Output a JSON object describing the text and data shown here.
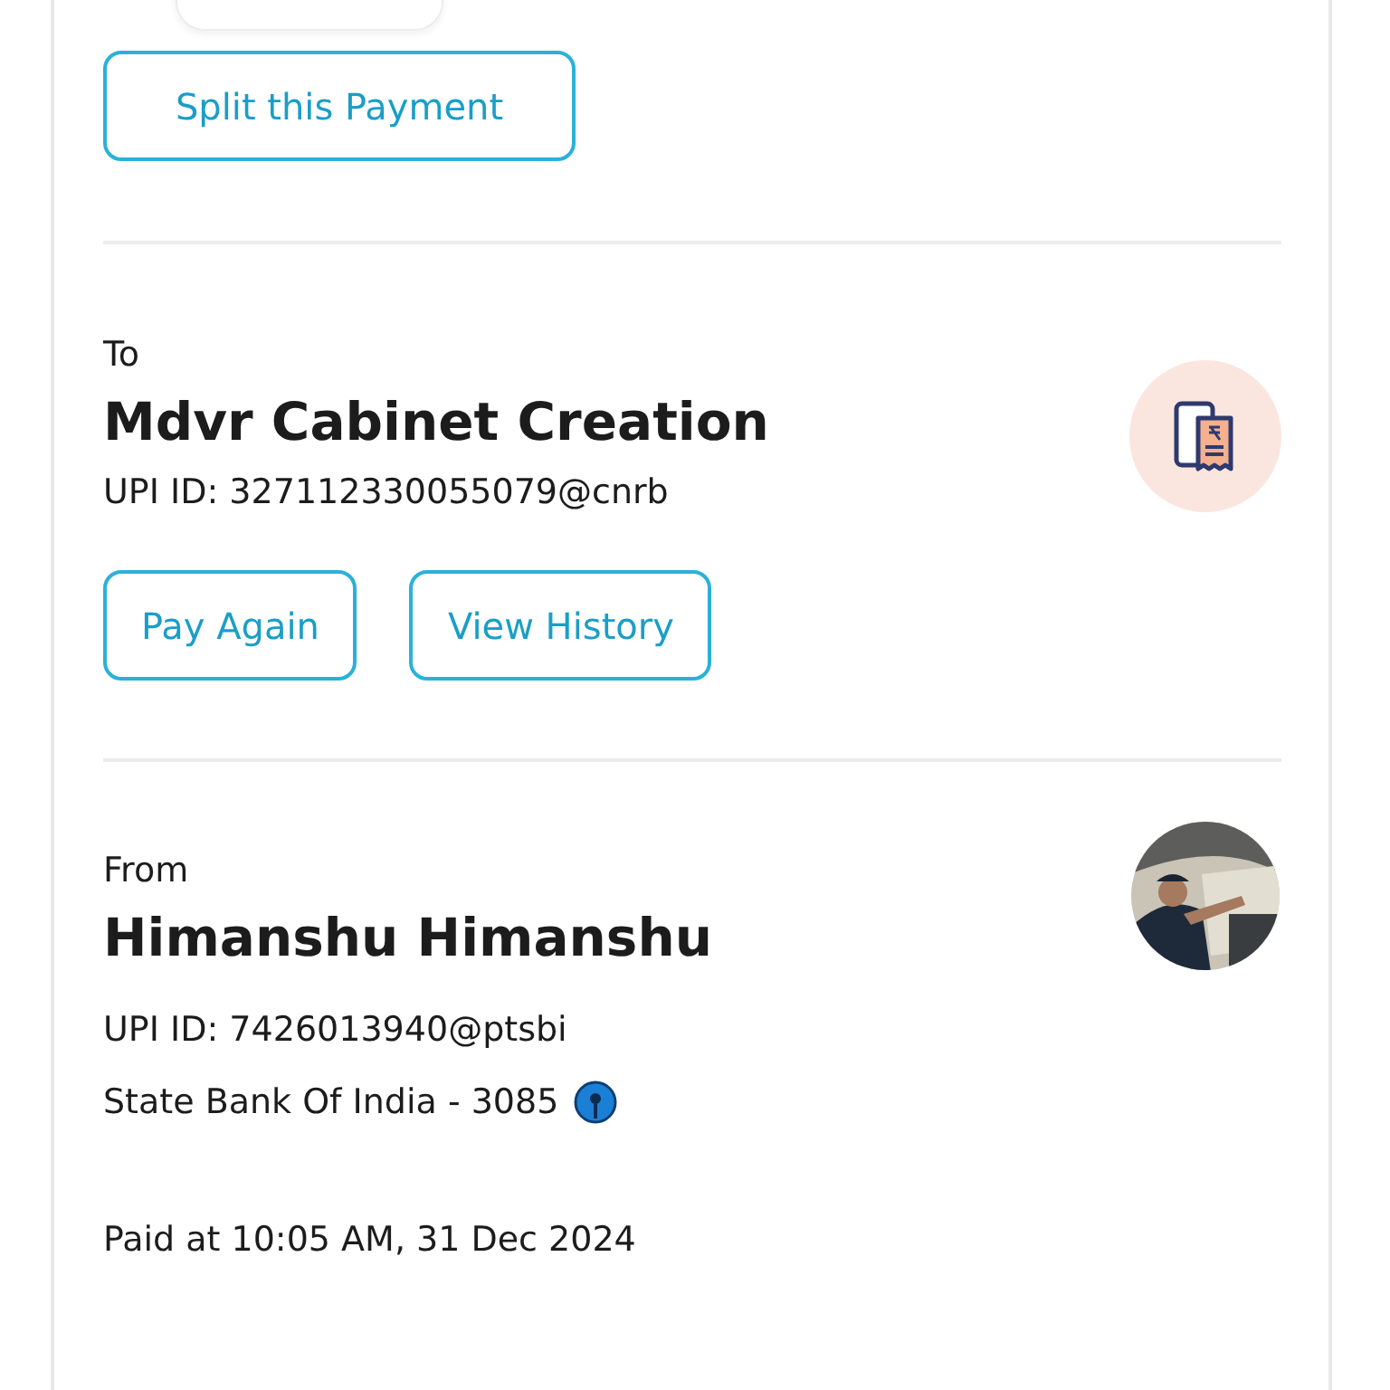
{
  "split_button": {
    "label": "Split this Payment"
  },
  "to": {
    "heading": "To",
    "name": "Mdvr Cabinet Creation",
    "upi_id": "UPI ID: 327112330055079@cnrb",
    "buttons": [
      {
        "label": "Pay Again"
      },
      {
        "label": "View History"
      }
    ]
  },
  "from": {
    "heading": "From",
    "name": "Himanshu Himanshu",
    "upi_id": "UPI ID: 7426013940@ptsbi",
    "bank": "State Bank Of India - 3085"
  },
  "paid_at": "Paid at 10:05 AM, 31 Dec 2024"
}
